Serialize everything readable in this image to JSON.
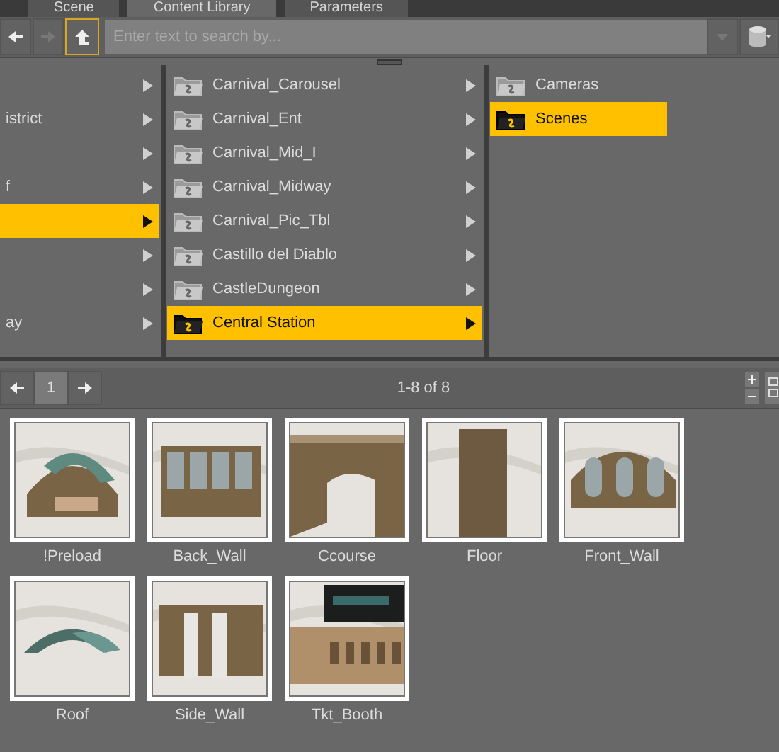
{
  "tabs": [
    {
      "label": "Scene",
      "selected": false
    },
    {
      "label": "Content Library",
      "selected": true
    },
    {
      "label": "Parameters",
      "selected": false
    }
  ],
  "search": {
    "placeholder": "Enter text to search by..."
  },
  "columns": [
    {
      "items": [
        {
          "selected": false
        },
        {
          "label": "istrict",
          "selected": false
        },
        {
          "selected": false
        },
        {
          "label": "f",
          "selected": false
        },
        {
          "selected": true
        },
        {
          "selected": false
        },
        {
          "selected": false
        },
        {
          "label": "ay",
          "selected": false
        }
      ]
    },
    {
      "items": [
        {
          "label": "Carnival_Carousel",
          "selected": false
        },
        {
          "label": "Carnival_Ent",
          "selected": false
        },
        {
          "label": "Carnival_Mid_I",
          "selected": false
        },
        {
          "label": "Carnival_Midway",
          "selected": false
        },
        {
          "label": "Carnival_Pic_Tbl",
          "selected": false
        },
        {
          "label": "Castillo del Diablo",
          "selected": false
        },
        {
          "label": "CastleDungeon",
          "selected": false
        },
        {
          "label": "Central Station",
          "selected": true
        }
      ]
    },
    {
      "items": [
        {
          "label": "Cameras",
          "selected": false
        },
        {
          "label": "Scenes",
          "selected": true
        }
      ]
    }
  ],
  "pager": {
    "page": "1",
    "range": "1-8 of 8"
  },
  "assets": [
    {
      "label": "!Preload"
    },
    {
      "label": "Back_Wall"
    },
    {
      "label": "Ccourse"
    },
    {
      "label": "Floor"
    },
    {
      "label": "Front_Wall"
    },
    {
      "label": "Roof"
    },
    {
      "label": "Side_Wall"
    },
    {
      "label": "Tkt_Booth"
    }
  ]
}
